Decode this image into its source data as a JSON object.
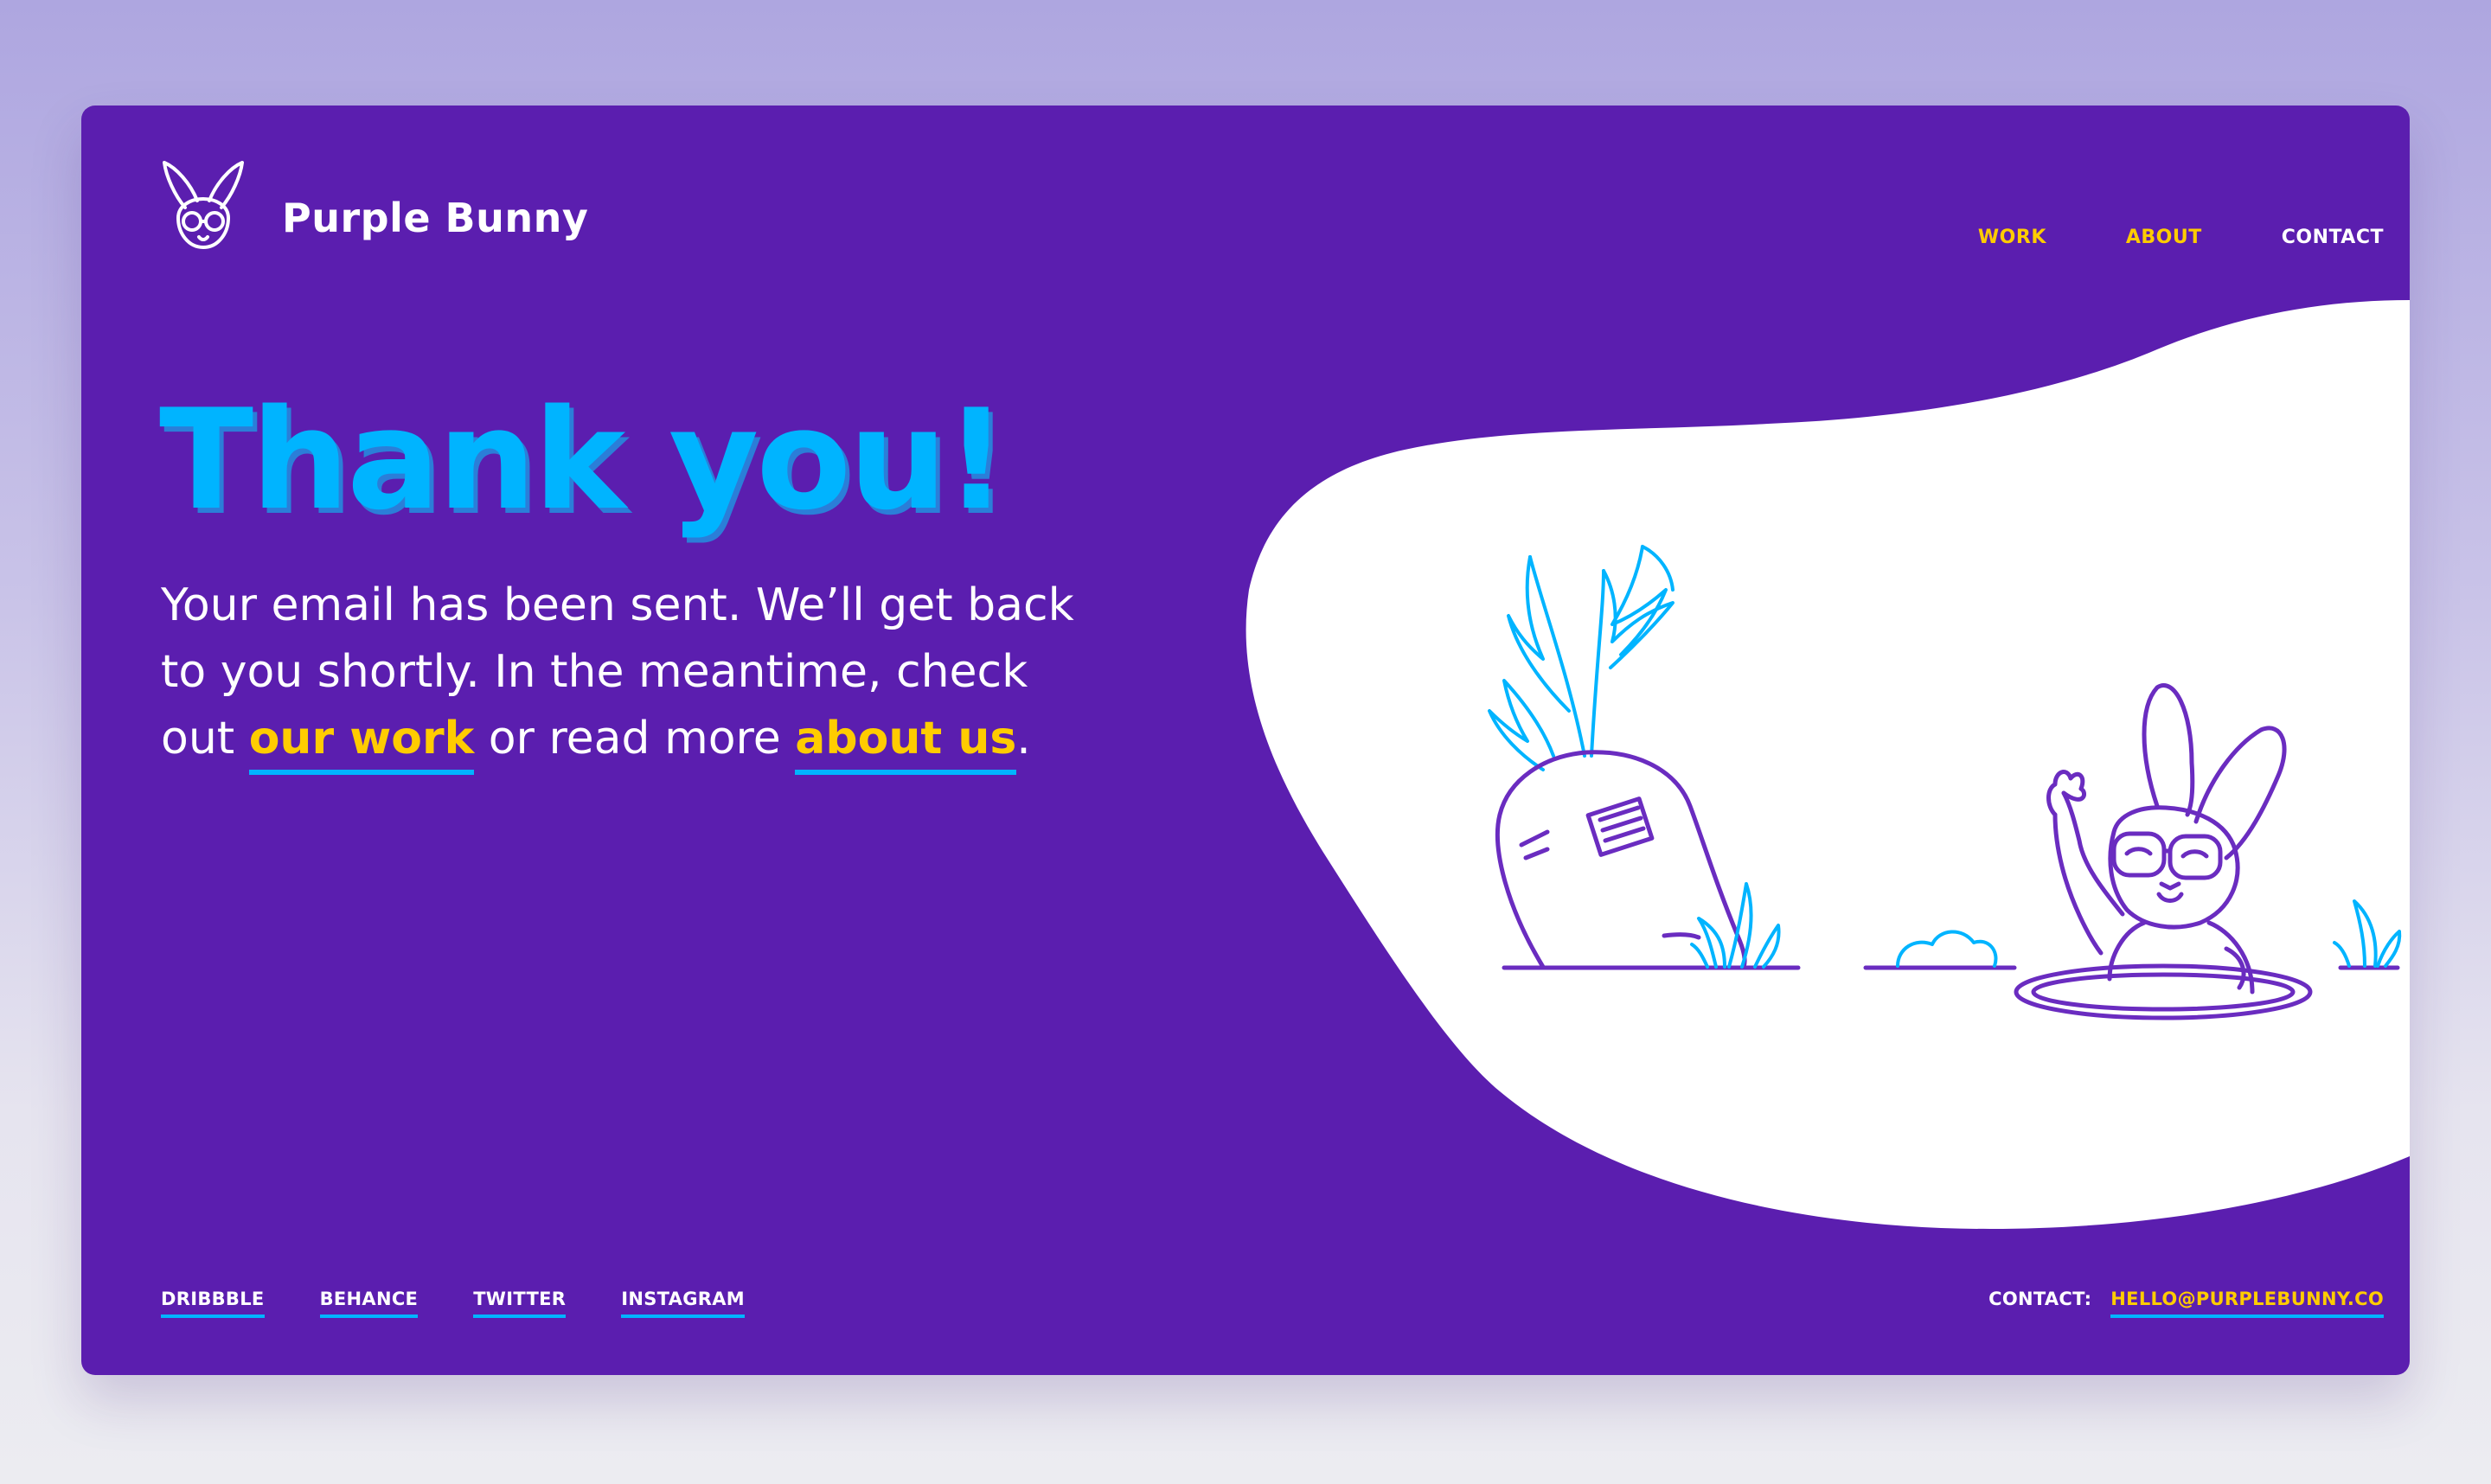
{
  "brand": {
    "name": "Purple Bunny",
    "logo_icon": "bunny-with-glasses-icon"
  },
  "nav": {
    "work": "WORK",
    "about": "ABOUT",
    "contact": "CONTACT"
  },
  "hero": {
    "headline": "Thank you!",
    "message_part1": "Your email has been sent. We’ll get back to you shortly. In the meantime, check out ",
    "link_work": "our work",
    "message_part2": " or read more ",
    "link_about": "about us",
    "message_end": "."
  },
  "footer": {
    "social": [
      "DRIBBBLE",
      "BEHANCE",
      "TWITTER",
      "INSTAGRAM"
    ],
    "contact_label": "CONTACT:",
    "contact_email": "HELLO@PURPLEBUNNY.CO"
  },
  "colors": {
    "background_card": "#5b1eaf",
    "accent_cyan": "#00b4ff",
    "accent_yellow": "#ffcc00",
    "text_white": "#ffffff"
  },
  "illustration": {
    "items": [
      "carrot-icon",
      "grass-tuft-icon",
      "dirt-mound-icon",
      "waving-bunny-icon",
      "rabbit-hole-icon"
    ]
  }
}
